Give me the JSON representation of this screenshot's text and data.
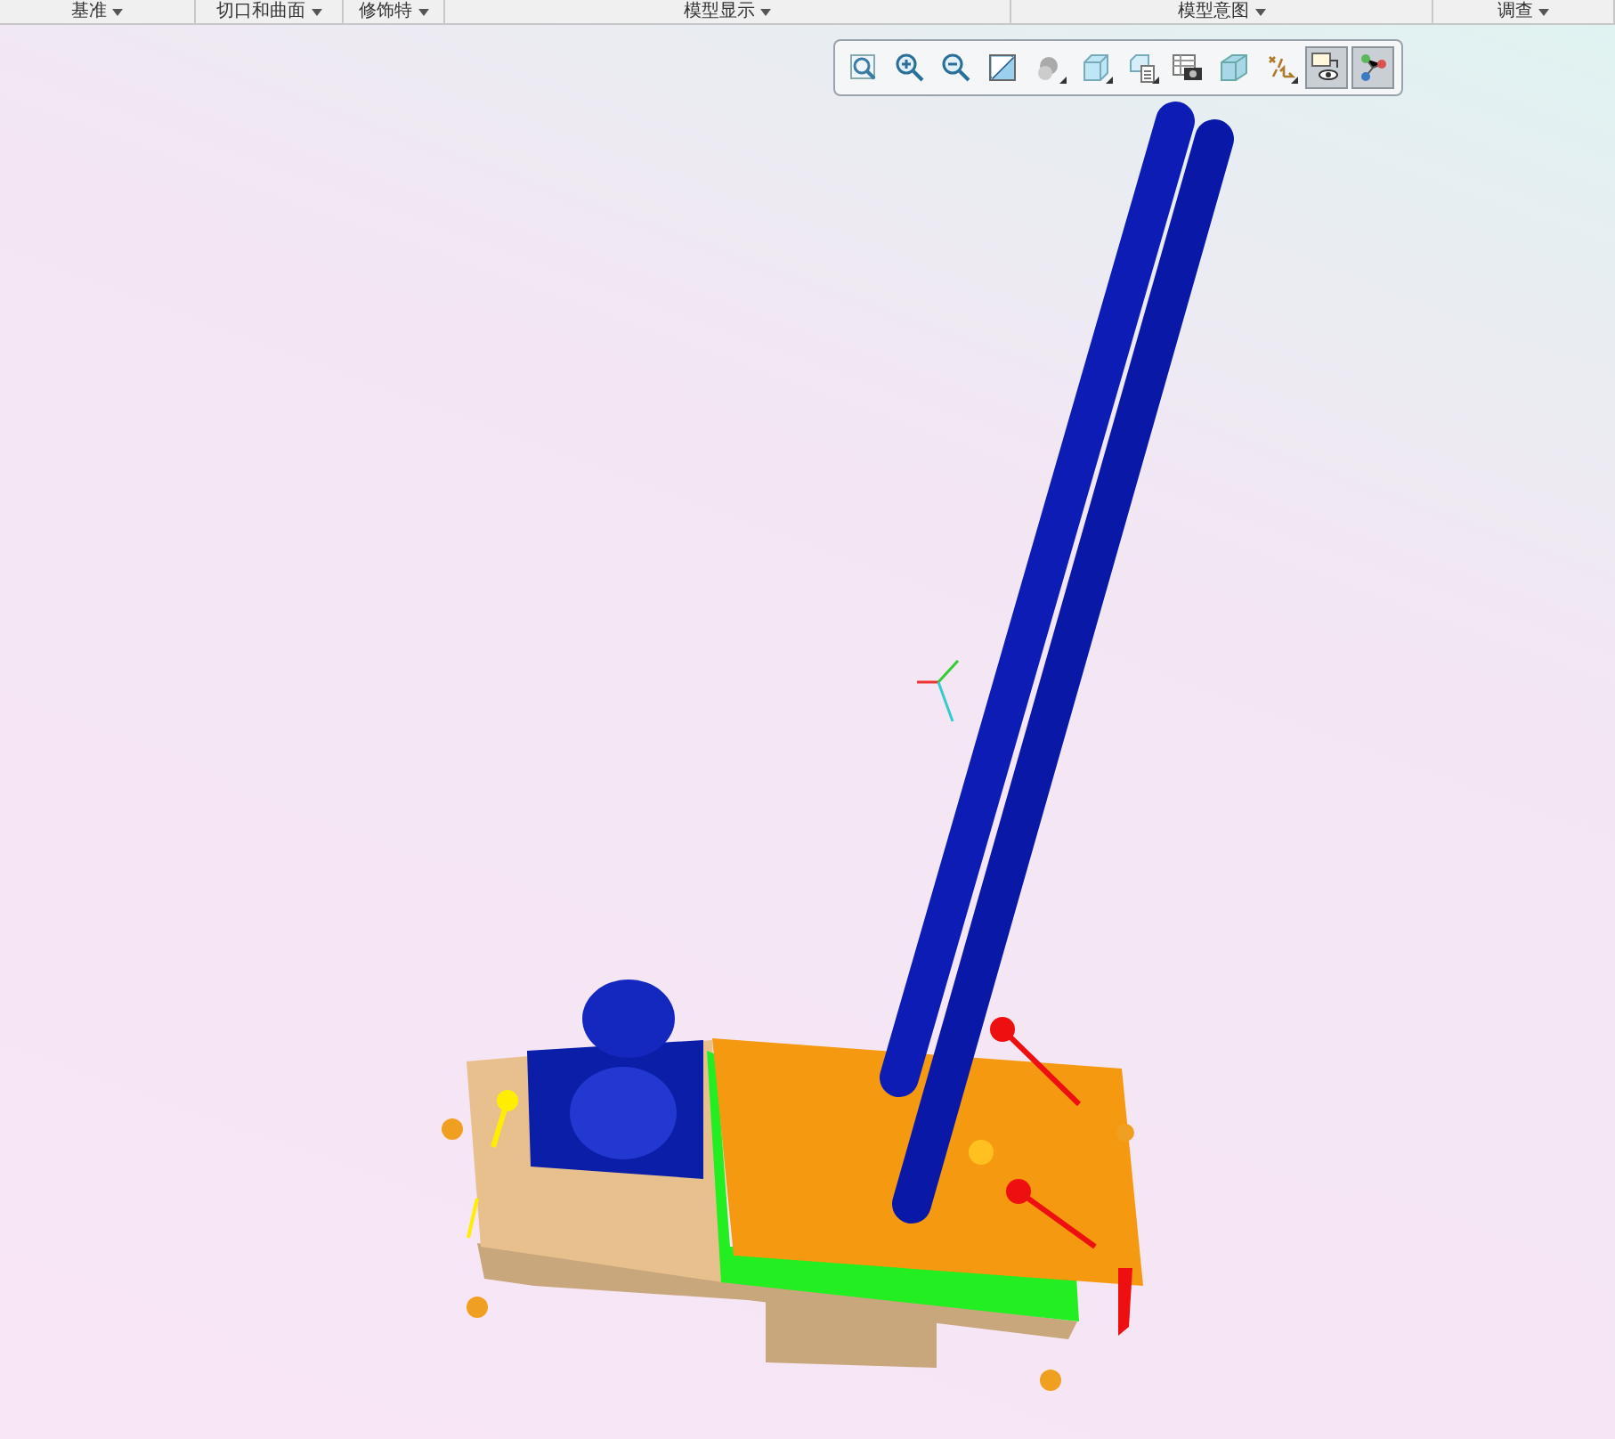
{
  "ribbon_groups": [
    {
      "label": "基准"
    },
    {
      "label": "切口和曲面"
    },
    {
      "label": "修饰特"
    },
    {
      "label": "模型显示"
    },
    {
      "label": "模型意图"
    },
    {
      "label": "调查"
    }
  ],
  "view_toolbar": {
    "buttons": [
      {
        "kind": "refit",
        "has_menu": false,
        "selected": false
      },
      {
        "kind": "zoom-in",
        "has_menu": false,
        "selected": false
      },
      {
        "kind": "zoom-out",
        "has_menu": false,
        "selected": false
      },
      {
        "kind": "repaint",
        "has_menu": false,
        "selected": false
      },
      {
        "kind": "display-style",
        "has_menu": true,
        "selected": false
      },
      {
        "kind": "saved-views",
        "has_menu": true,
        "selected": false
      },
      {
        "kind": "view-manager",
        "has_menu": true,
        "selected": false
      },
      {
        "kind": "snapshot",
        "has_menu": false,
        "selected": false
      },
      {
        "kind": "perspective",
        "has_menu": false,
        "selected": false
      },
      {
        "kind": "datum-display",
        "has_menu": true,
        "selected": false
      },
      {
        "kind": "annotation-display",
        "has_menu": false,
        "selected": true
      },
      {
        "kind": "spin-center",
        "has_menu": false,
        "selected": true
      }
    ]
  }
}
